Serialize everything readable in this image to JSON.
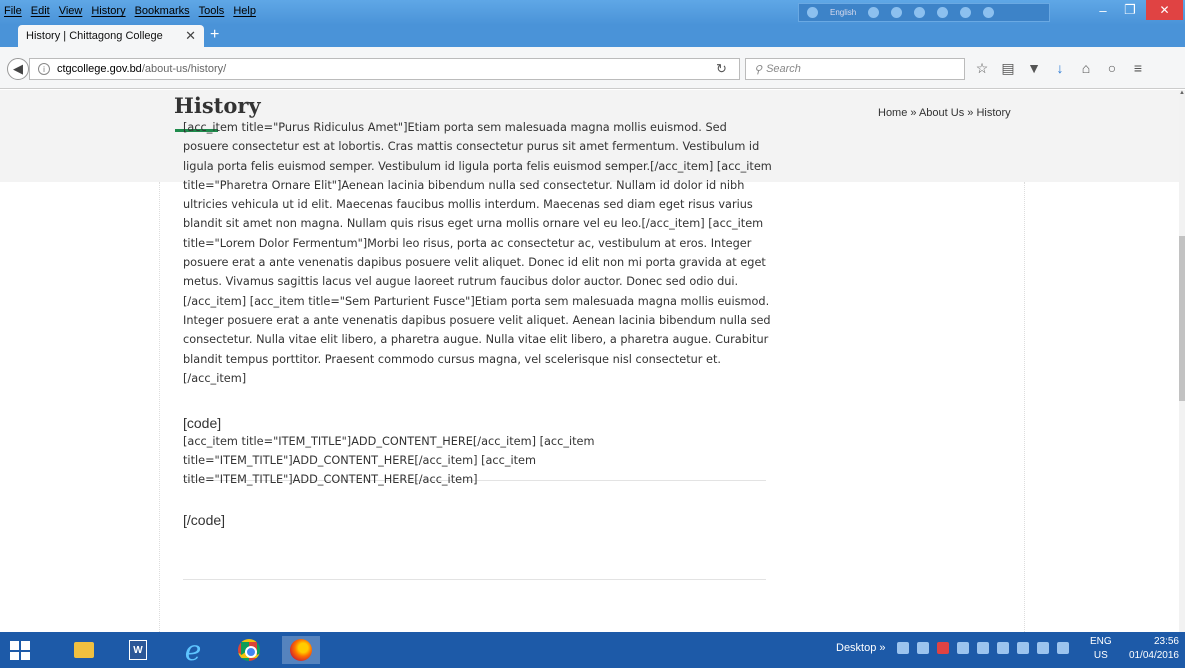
{
  "menubar": {
    "items": [
      "File",
      "Edit",
      "View",
      "History",
      "Bookmarks",
      "Tools",
      "Help"
    ]
  },
  "ie_toolbar": {
    "language": "English"
  },
  "window_controls": {
    "minimize": "–",
    "maximize": "❐",
    "close": "✕"
  },
  "tab": {
    "title": "History | Chittagong College",
    "close": "✕",
    "new_tab": "+"
  },
  "navbar": {
    "url_host": "ctgcollege.gov.bd",
    "url_path": "/about-us/history/",
    "search_placeholder": "Search",
    "icons": [
      "star-icon",
      "reading-list-icon",
      "pocket-icon",
      "download-icon",
      "home-icon",
      "chat-icon",
      "menu-icon"
    ]
  },
  "page": {
    "title": "History",
    "breadcrumb": "Home » About Us » History",
    "body": "[acc_item title=\"Purus Ridiculus Amet\"]Etiam porta sem malesuada magna mollis euismod. Sed posuere consectetur est at lobortis. Cras mattis consectetur purus sit amet fermentum. Vestibulum id ligula porta felis euismod semper. Vestibulum id ligula porta felis euismod semper.[/acc_item] [acc_item title=\"Pharetra Ornare Elit\"]Aenean lacinia bibendum nulla sed consectetur. Nullam id dolor id nibh ultricies vehicula ut id elit. Maecenas faucibus mollis interdum. Maecenas sed diam eget risus varius blandit sit amet non magna. Nullam quis risus eget urna mollis ornare vel eu leo.[/acc_item] [acc_item title=\"Lorem Dolor Fermentum\"]Morbi leo risus, porta ac consectetur ac, vestibulum at eros. Integer posuere erat a ante venenatis dapibus posuere velit aliquet. Donec id elit non mi porta gravida at eget metus. Vivamus sagittis lacus vel augue laoreet rutrum faucibus dolor auctor. Donec sed odio dui.[/acc_item] [acc_item title=\"Sem Parturient Fusce\"]Etiam porta sem malesuada magna mollis euismod. Integer posuere erat a ante venenatis dapibus posuere velit aliquet. Aenean lacinia bibendum nulla sed consectetur. Nulla vitae elit libero, a pharetra augue. Nulla vitae elit libero, a pharetra augue. Curabitur blandit tempus porttitor. Praesent commodo cursus magna, vel scelerisque nisl consectetur et.[/acc_item]",
    "code_open": "[code]",
    "code_body": "[acc_item title=\"ITEM_TITLE\"]ADD_CONTENT_HERE[/acc_item] [acc_item title=\"ITEM_TITLE\"]ADD_CONTENT_HERE[/acc_item] [acc_item title=\"ITEM_TITLE\"]ADD_CONTENT_HERE[/acc_item]",
    "code_close": "[/code]"
  },
  "taskbar": {
    "desktop": "Desktop",
    "chevron": "»",
    "language": "ENG",
    "region": "US",
    "time": "23:56",
    "date": "01/04/2016"
  }
}
